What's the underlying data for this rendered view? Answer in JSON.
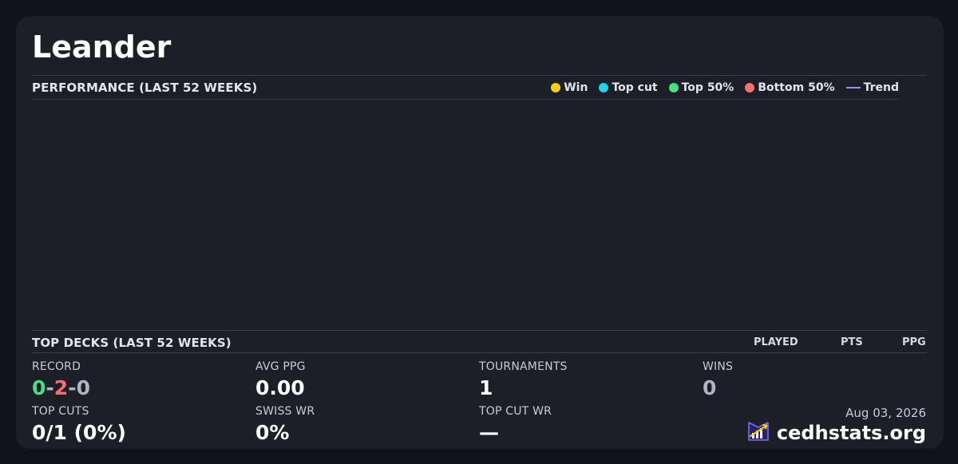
{
  "player": {
    "name": "Leander"
  },
  "performance": {
    "title": "PERFORMANCE (LAST 52 WEEKS)",
    "legend": [
      {
        "label": "Win",
        "color": "#facc15",
        "kind": "dot",
        "icon": "win-dot-icon"
      },
      {
        "label": "Top cut",
        "color": "#22d3ee",
        "kind": "dot",
        "icon": "top-cut-dot-icon"
      },
      {
        "label": "Top 50%",
        "color": "#4ade80",
        "kind": "dot",
        "icon": "top-50-dot-icon"
      },
      {
        "label": "Bottom 50%",
        "color": "#f87171",
        "kind": "dot",
        "icon": "bottom-50-dot-icon"
      },
      {
        "label": "Trend",
        "color": "#a78bfa",
        "kind": "line",
        "icon": "trend-line-icon"
      }
    ]
  },
  "top_decks": {
    "title": "TOP DECKS (LAST 52 WEEKS)",
    "columns": [
      "PLAYED",
      "PTS",
      "PPG"
    ]
  },
  "stats": {
    "record": {
      "label": "RECORD",
      "wins": "0",
      "losses": "2",
      "draws": "0",
      "sep": "-"
    },
    "avg_ppg": {
      "label": "AVG PPG",
      "value": "0.00"
    },
    "tournaments": {
      "label": "TOURNAMENTS",
      "value": "1"
    },
    "wins": {
      "label": "WINS",
      "value": "0"
    },
    "top_cuts": {
      "label": "TOP CUTS",
      "value": "0/1 (0%)"
    },
    "swiss_wr": {
      "label": "SWISS WR",
      "value": "0%"
    },
    "top_cut_wr": {
      "label": "TOP CUT WR",
      "value": "—"
    }
  },
  "footer": {
    "date": "Aug 03, 2026",
    "brand": "cedhstats.org",
    "logo_icon": "cedhstats-logo-icon"
  },
  "colors": {
    "win": "#4ade80",
    "loss": "#f87171",
    "draw": "#aeb3c1",
    "card_bg": "#1c1e28",
    "page_bg": "#111318"
  }
}
